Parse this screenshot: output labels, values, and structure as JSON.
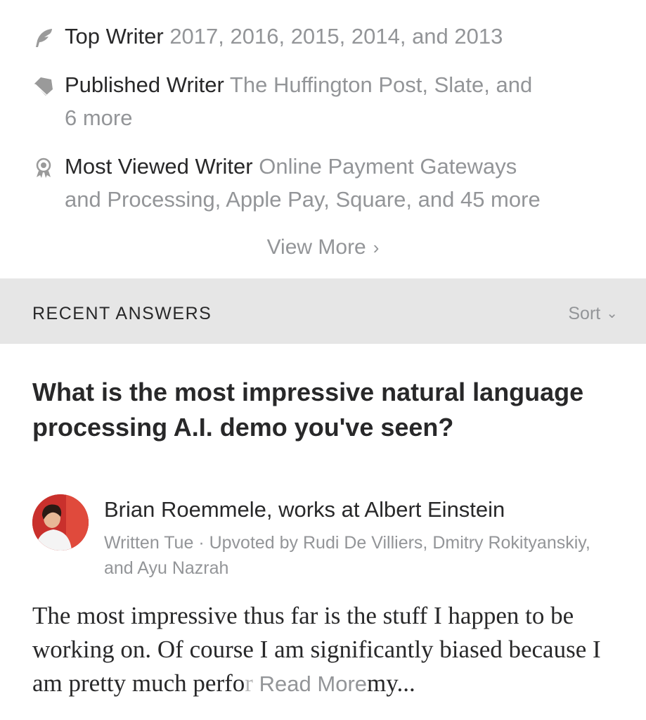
{
  "credentials": [
    {
      "icon": "quill-icon",
      "title": "Top Writer",
      "detail": "2017, 2016, 2015, 2014, and 2013",
      "detail_cont": ""
    },
    {
      "icon": "tag-icon",
      "title": "Published Writer",
      "detail": "The Huffington Post, Slate, and",
      "detail_cont": "6 more"
    },
    {
      "icon": "award-icon",
      "title": "Most Viewed Writer",
      "detail": "Online Payment Gateways",
      "detail_cont": "and Processing, Apple Pay, Square, and 45 more"
    }
  ],
  "view_more": {
    "label": "View More",
    "chevron": "›"
  },
  "section": {
    "title": "RECENT ANSWERS",
    "sort_label": "Sort",
    "sort_chevron": "⌄"
  },
  "answer": {
    "question": "What is the most impressive natural language processing A.I. demo you've seen?",
    "author": "Brian Roemmele, works at Albert Einstein",
    "meta": "Written Tue · Upvoted by Rudi De Villiers, Dmitry Rokityanskiy, and Ayu Nazrah",
    "body_text": "The most impressive thus far is the stuff I happen to be working on. Of course I am significantly biased because I am pretty much perfo",
    "body_fade": "r",
    "read_more": "Read More",
    "body_tail": "my..."
  },
  "colors": {
    "primary_text": "#282829",
    "secondary_text": "#939598",
    "section_bg": "#e6e6e6",
    "icon": "#9a9a9a"
  }
}
